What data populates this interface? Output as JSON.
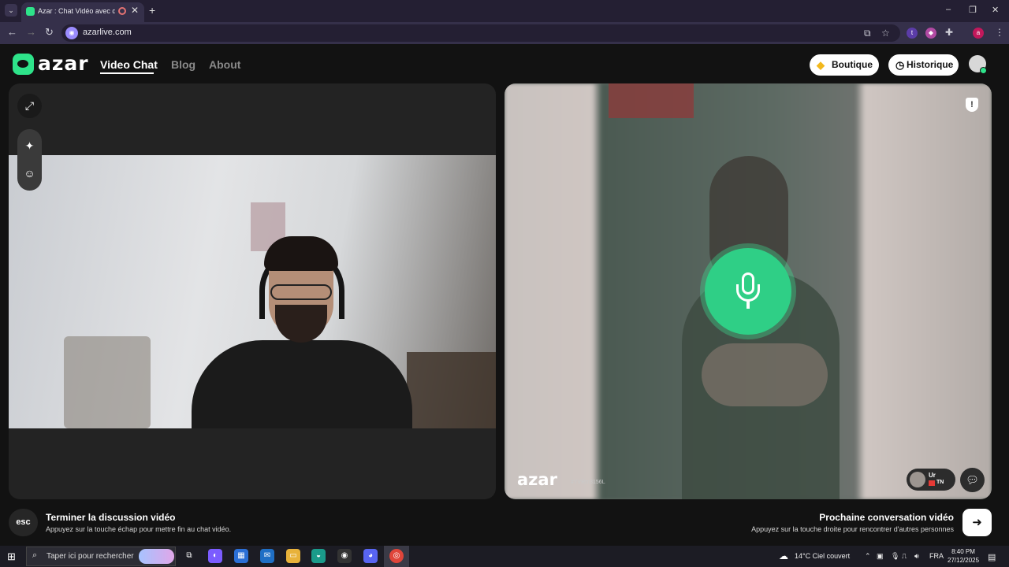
{
  "browser": {
    "tab_title": "Azar : Chat Vidéo avec de n",
    "url": "azarlive.com",
    "close_tab": "✕",
    "new_tab": "+",
    "ext_initials": [
      "t",
      "a"
    ]
  },
  "header": {
    "logo": "azar",
    "nav": [
      "Video Chat",
      "Blog",
      "About"
    ],
    "shop_label": "Boutique",
    "history_label": "Historique"
  },
  "remote": {
    "watermark_logo": "azar",
    "watermark_id": "#YVRm3156L",
    "partner_name": "Ur",
    "partner_country": "TN"
  },
  "footer": {
    "esc_key": "esc",
    "end_title": "Terminer la discussion vidéo",
    "end_sub": "Appuyez sur la touche échap pour mettre fin au chat vidéo.",
    "next_title": "Prochaine conversation vidéo",
    "next_sub": "Appuyez sur la touche droite pour rencontrer d'autres personnes"
  },
  "taskbar": {
    "search_placeholder": "Taper ici pour rechercher",
    "weather": "14°C  Ciel couvert",
    "language": "FRA",
    "time": "8:40 PM",
    "date": "27/12/2025"
  },
  "colors": {
    "brand_green": "#2ee38a",
    "mic_green": "#2fcf86"
  }
}
